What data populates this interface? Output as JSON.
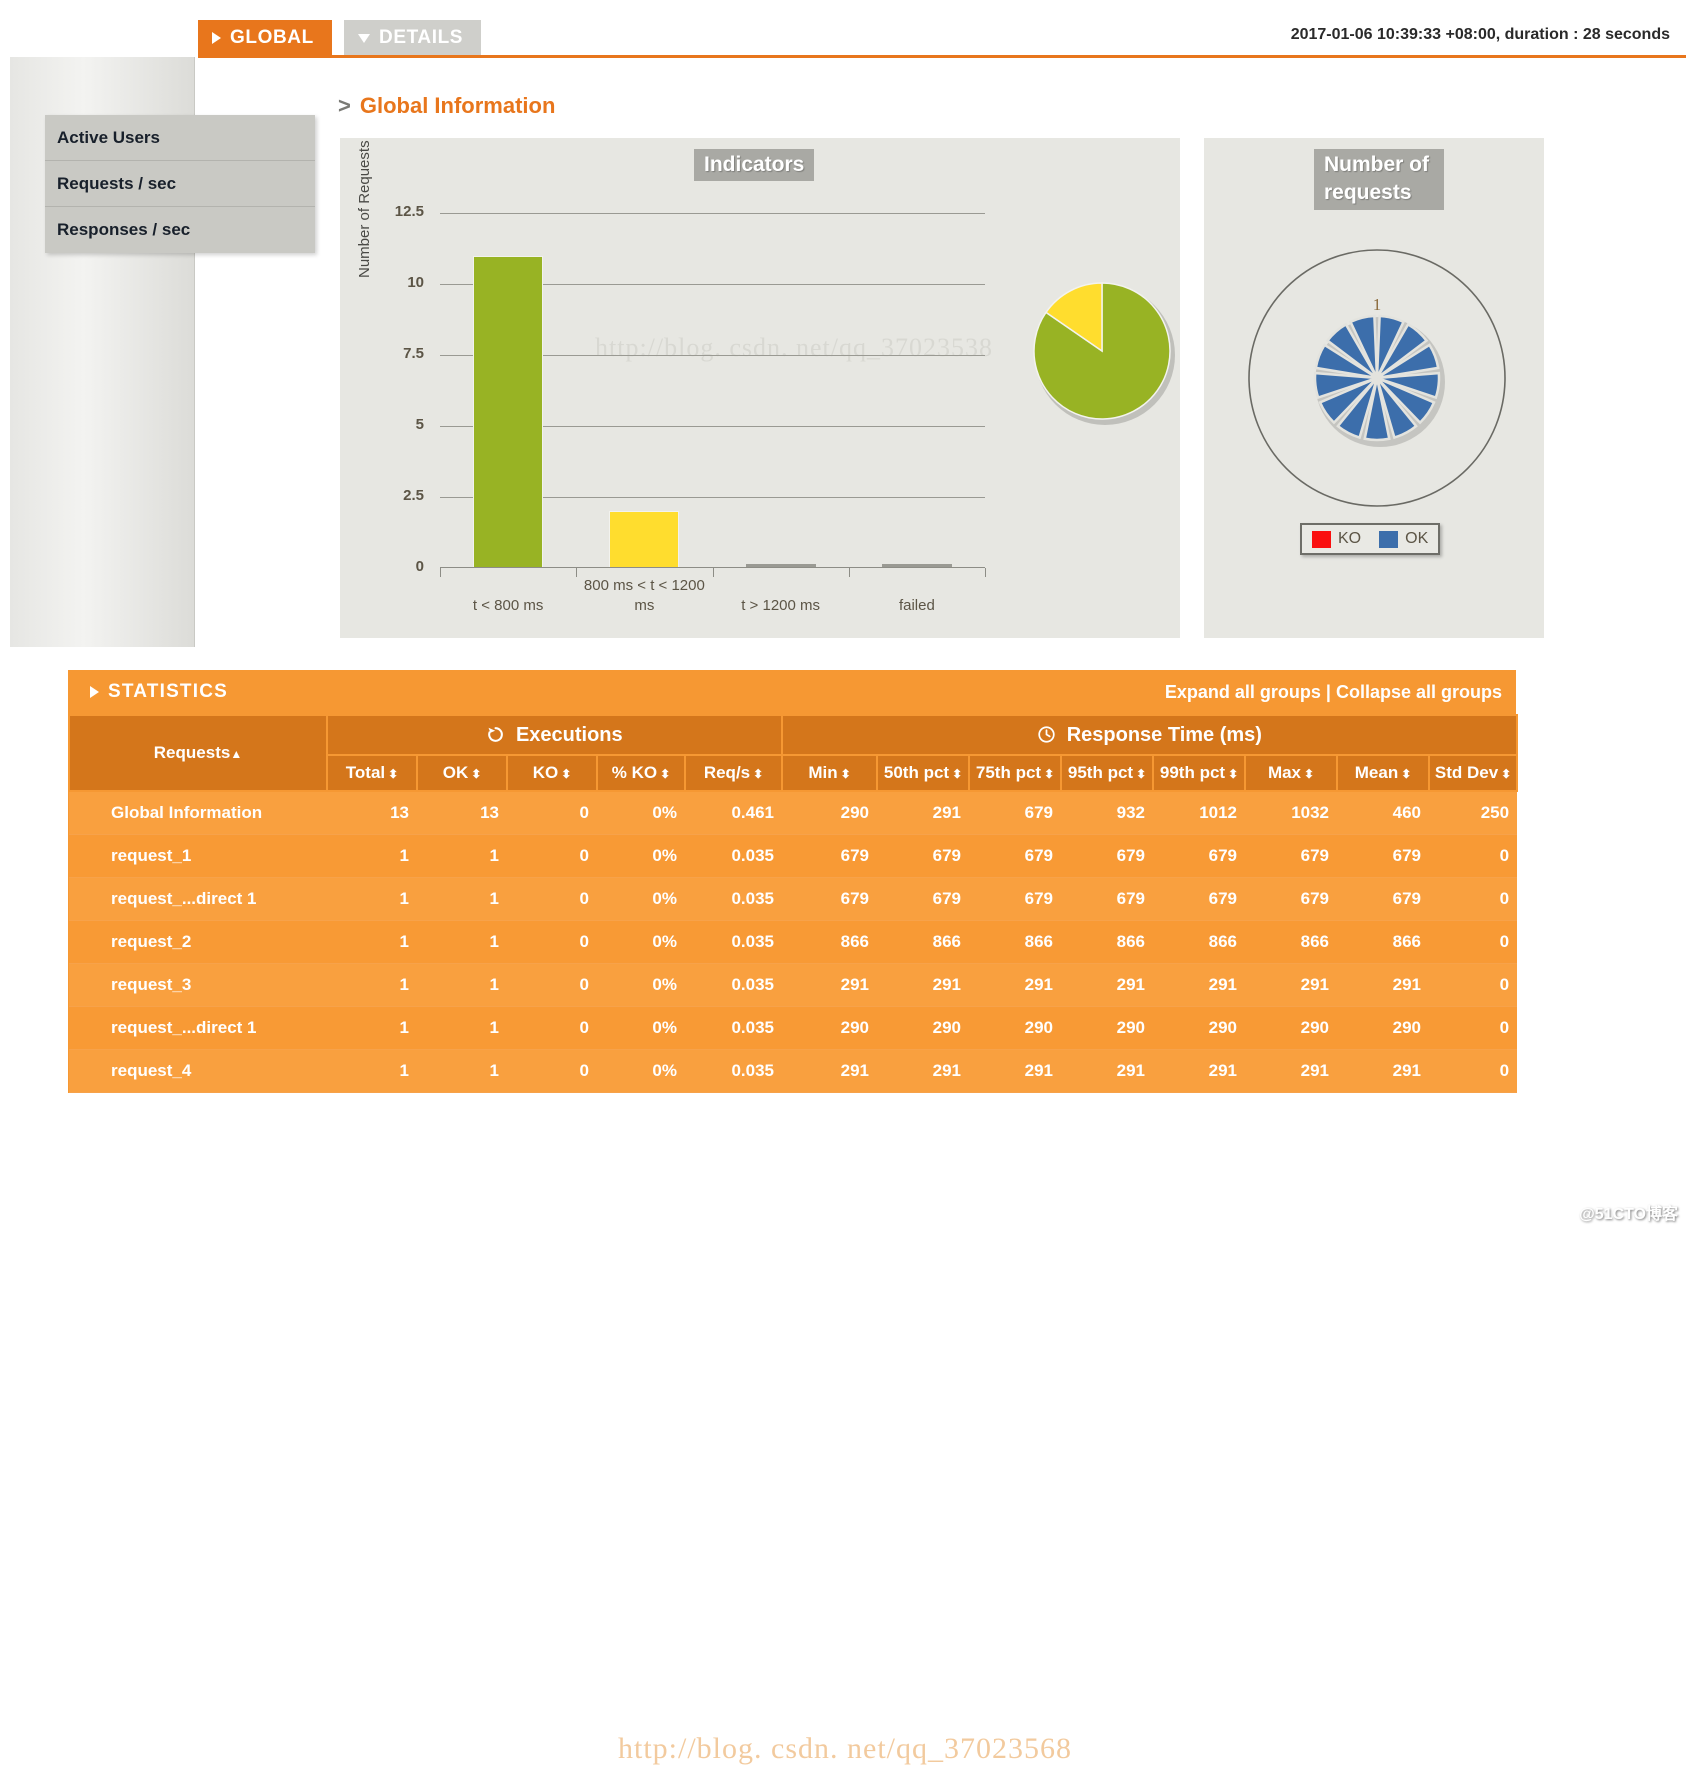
{
  "header": {
    "tabs": [
      {
        "label": "GLOBAL",
        "icon": "triangle-right-icon",
        "active": true
      },
      {
        "label": "DETAILS",
        "icon": "triangle-down-icon",
        "active": false
      }
    ],
    "run_info": "2017-01-06 10:39:33 +08:00, duration : 28 seconds"
  },
  "sidebar": {
    "items": [
      {
        "label": "Active Users"
      },
      {
        "label": "Requests / sec"
      },
      {
        "label": "Responses / sec"
      }
    ]
  },
  "main": {
    "section_marker": ">",
    "section_title": "Global Information"
  },
  "watermarks": {
    "one": "http://blog. csdn. net/qq_37023538",
    "two": "http://blog. csdn. net/qq_37023568"
  },
  "panels": {
    "indicators_title": "Indicators",
    "requests_title": "Number of requests",
    "requests_legend": [
      {
        "label": "KO",
        "color": "#fa0f0f"
      },
      {
        "label": "OK",
        "color": "#3c6eab"
      }
    ]
  },
  "chart_data": [
    {
      "type": "bar",
      "title": "Indicators",
      "xlabel": "",
      "ylabel": "Number of Requests",
      "categories": [
        "t < 800 ms",
        "800 ms < t < 1200 ms",
        "t > 1200 ms",
        "failed"
      ],
      "values": [
        11,
        2,
        0,
        0
      ],
      "colors": [
        "#98b324",
        "#ffdd2e",
        "#f38b00",
        "#f21d1d"
      ],
      "ylim": [
        0,
        13.2
      ],
      "yticks": [
        0,
        2.5,
        5,
        7.5,
        10,
        12.5
      ],
      "ytick_labels": [
        "0",
        "2.5",
        "5",
        "7.5",
        "10",
        "12.5"
      ],
      "grid": true,
      "legend": "none"
    },
    {
      "type": "pie",
      "title": "Indicators",
      "labels": [
        "t < 800 ms",
        "800 ms < t < 1200 ms"
      ],
      "values": [
        11,
        2
      ],
      "colors": [
        "#98b324",
        "#ffdd2e"
      ],
      "legend": "none"
    },
    {
      "type": "pie",
      "title": "Number of requests",
      "labels": [
        "KO",
        "OK"
      ],
      "values": [
        0,
        13
      ],
      "colors": [
        "#fa0f0f",
        "#3c6eab"
      ],
      "slice_count": 13,
      "annotation": "1",
      "legend": "bottom"
    }
  ],
  "statistics": {
    "title": "STATISTICS",
    "icon": "triangle-right-icon",
    "expand_all": "Expand all groups",
    "separator": "|",
    "collapse_all": "Collapse all groups",
    "group_headers": [
      {
        "label": "Executions",
        "icon": "refresh-icon"
      },
      {
        "label": "Response Time (ms)",
        "icon": "clock-icon"
      }
    ],
    "first_col_header": "Requests",
    "first_col_sort": "▲",
    "columns": [
      "Total",
      "OK",
      "KO",
      "% KO",
      "Req/s",
      "Min",
      "50th pct",
      "75th pct",
      "95th pct",
      "99th pct",
      "Max",
      "Mean",
      "Std Dev"
    ],
    "sort_glyph": "⬍",
    "rows": [
      {
        "name": "Global Information",
        "cells": [
          "13",
          "13",
          "0",
          "0%",
          "0.461",
          "290",
          "291",
          "679",
          "932",
          "1012",
          "1032",
          "460",
          "250"
        ]
      },
      {
        "name": "request_1",
        "cells": [
          "1",
          "1",
          "0",
          "0%",
          "0.035",
          "679",
          "679",
          "679",
          "679",
          "679",
          "679",
          "679",
          "0"
        ]
      },
      {
        "name": "request_...direct 1",
        "cells": [
          "1",
          "1",
          "0",
          "0%",
          "0.035",
          "679",
          "679",
          "679",
          "679",
          "679",
          "679",
          "679",
          "0"
        ]
      },
      {
        "name": "request_2",
        "cells": [
          "1",
          "1",
          "0",
          "0%",
          "0.035",
          "866",
          "866",
          "866",
          "866",
          "866",
          "866",
          "866",
          "0"
        ]
      },
      {
        "name": "request_3",
        "cells": [
          "1",
          "1",
          "0",
          "0%",
          "0.035",
          "291",
          "291",
          "291",
          "291",
          "291",
          "291",
          "291",
          "0"
        ]
      },
      {
        "name": "request_...direct 1",
        "cells": [
          "1",
          "1",
          "0",
          "0%",
          "0.035",
          "290",
          "290",
          "290",
          "290",
          "290",
          "290",
          "290",
          "0"
        ]
      },
      {
        "name": "request_4",
        "cells": [
          "1",
          "1",
          "0",
          "0%",
          "0.035",
          "291",
          "291",
          "291",
          "291",
          "291",
          "291",
          "291",
          "0"
        ]
      }
    ]
  },
  "footer_badge": "@51CTO博客"
}
